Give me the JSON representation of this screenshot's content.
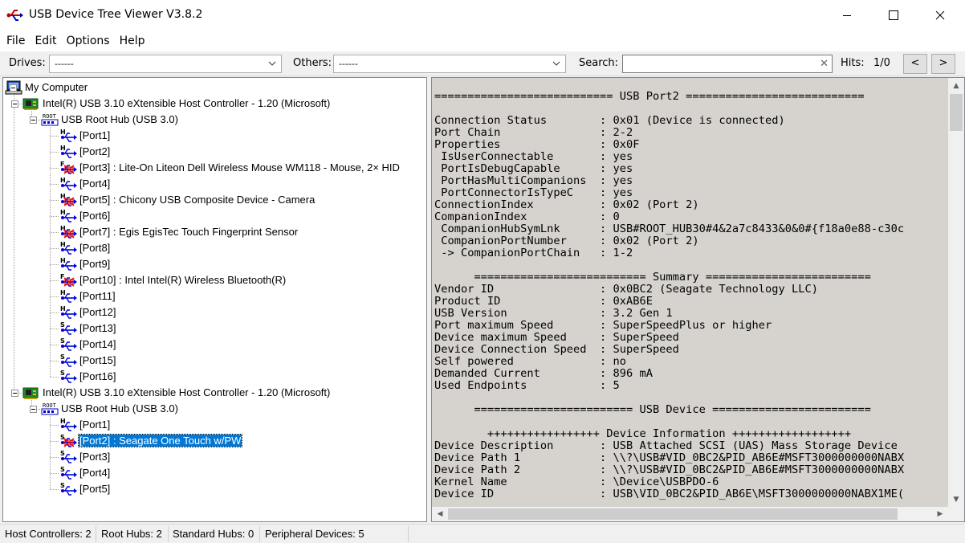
{
  "window": {
    "title": "USB Device Tree Viewer V3.8.2"
  },
  "menu": [
    "File",
    "Edit",
    "Options",
    "Help"
  ],
  "toolbar": {
    "drives_label": "Drives:",
    "drives_value": "------",
    "others_label": "Others:",
    "others_value": "------",
    "search_label": "Search:",
    "search_value": "",
    "hits_label": "Hits:",
    "hits_value": "1/0",
    "prev_label": "<",
    "next_label": ">"
  },
  "tree": [
    {
      "text": "My Computer",
      "icon": "computer-icon"
    },
    {
      "text": "Intel(R) USB 3.10 eXtensible Host Controller - 1.20 (Microsoft)",
      "icon": "host-controller-icon"
    },
    {
      "text": "USB Root Hub (USB 3.0)",
      "icon": "root-hub-icon"
    },
    {
      "text": "[Port1]",
      "icon": "usb-port-icon",
      "badge": "H"
    },
    {
      "text": "[Port2]",
      "icon": "usb-port-icon",
      "badge": "H"
    },
    {
      "text": "[Port3] : Lite-On Liteon Dell Wireless Mouse WM118 - Mouse, 2× HID",
      "icon": "usb-device-icon",
      "badge": "F"
    },
    {
      "text": "[Port4]",
      "icon": "usb-port-icon",
      "badge": "H"
    },
    {
      "text": "[Port5] : Chicony USB Composite Device - Camera",
      "icon": "usb-device-icon",
      "badge": "H"
    },
    {
      "text": "[Port6]",
      "icon": "usb-port-icon",
      "badge": "H"
    },
    {
      "text": "[Port7] : Egis EgisTec Touch Fingerprint Sensor",
      "icon": "usb-device-icon",
      "badge": "H"
    },
    {
      "text": "[Port8]",
      "icon": "usb-port-icon",
      "badge": "H"
    },
    {
      "text": "[Port9]",
      "icon": "usb-port-icon",
      "badge": "H"
    },
    {
      "text": "[Port10] : Intel Intel(R) Wireless Bluetooth(R)",
      "icon": "usb-device-icon",
      "badge": "F"
    },
    {
      "text": "[Port11]",
      "icon": "usb-port-icon",
      "badge": "H"
    },
    {
      "text": "[Port12]",
      "icon": "usb-port-icon",
      "badge": "H"
    },
    {
      "text": "[Port13]",
      "icon": "usb-port-icon",
      "badge": "S"
    },
    {
      "text": "[Port14]",
      "icon": "usb-port-icon",
      "badge": "S"
    },
    {
      "text": "[Port15]",
      "icon": "usb-port-icon",
      "badge": "S"
    },
    {
      "text": "[Port16]",
      "icon": "usb-port-icon",
      "badge": "S"
    },
    {
      "text": "Intel(R) USB 3.10 eXtensible Host Controller - 1.20 (Microsoft)",
      "icon": "host-controller-icon"
    },
    {
      "text": "USB Root Hub (USB 3.0)",
      "icon": "root-hub-icon"
    },
    {
      "text": "[Port1]",
      "icon": "usb-port-icon",
      "badge": "H"
    },
    {
      "text": "[Port2] : Seagate One Touch w/PW",
      "icon": "usb-device-icon",
      "badge": "S",
      "selected": true
    },
    {
      "text": "[Port3]",
      "icon": "usb-port-icon",
      "badge": "S"
    },
    {
      "text": "[Port4]",
      "icon": "usb-port-icon",
      "badge": "S"
    },
    {
      "text": "[Port5]",
      "icon": "usb-port-icon",
      "badge": "S"
    }
  ],
  "detail_text": "=========================== USB Port2 ===========================\n\nConnection Status        : 0x01 (Device is connected)\nPort Chain               : 2-2\nProperties               : 0x0F\n IsUserConnectable       : yes\n PortIsDebugCapable      : yes\n PortHasMultiCompanions  : yes\n PortConnectorIsTypeC    : yes\nConnectionIndex          : 0x02 (Port 2)\nCompanionIndex           : 0\n CompanionHubSymLnk      : USB#ROOT_HUB30#4&2a7c8433&0&0#{f18a0e88-c30c\n CompanionPortNumber     : 0x02 (Port 2)\n -> CompanionPortChain   : 1-2\n\n      ========================== Summary =========================\nVendor ID                : 0x0BC2 (Seagate Technology LLC)\nProduct ID               : 0xAB6E\nUSB Version              : 3.2 Gen 1\nPort maximum Speed       : SuperSpeedPlus or higher\nDevice maximum Speed     : SuperSpeed\nDevice Connection Speed  : SuperSpeed\nSelf powered             : no\nDemanded Current         : 896 mA\nUsed Endpoints           : 5\n\n      ======================== USB Device ========================\n\n        +++++++++++++++++ Device Information ++++++++++++++++++\nDevice Description       : USB Attached SCSI (UAS) Mass Storage Device\nDevice Path 1            : \\\\?\\USB#VID_0BC2&PID_AB6E#MSFT3000000000NABX\nDevice Path 2            : \\\\?\\USB#VID_0BC2&PID_AB6E#MSFT3000000000NABX\nKernel Name              : \\Device\\USBPDO-6\nDevice ID                : USB\\VID_0BC2&PID_AB6E\\MSFT3000000000NABX1ME(",
  "status": {
    "host_controllers": "Host Controllers: 2",
    "root_hubs": "Root Hubs: 2",
    "standard_hubs": "Standard Hubs: 0",
    "peripheral_devices": "Peripheral Devices: 5"
  },
  "colors": {
    "selection": "#0078d7",
    "detail_bg": "#d6d3ce",
    "usb_blue": "#0000e0",
    "usb_red": "#e00000"
  }
}
